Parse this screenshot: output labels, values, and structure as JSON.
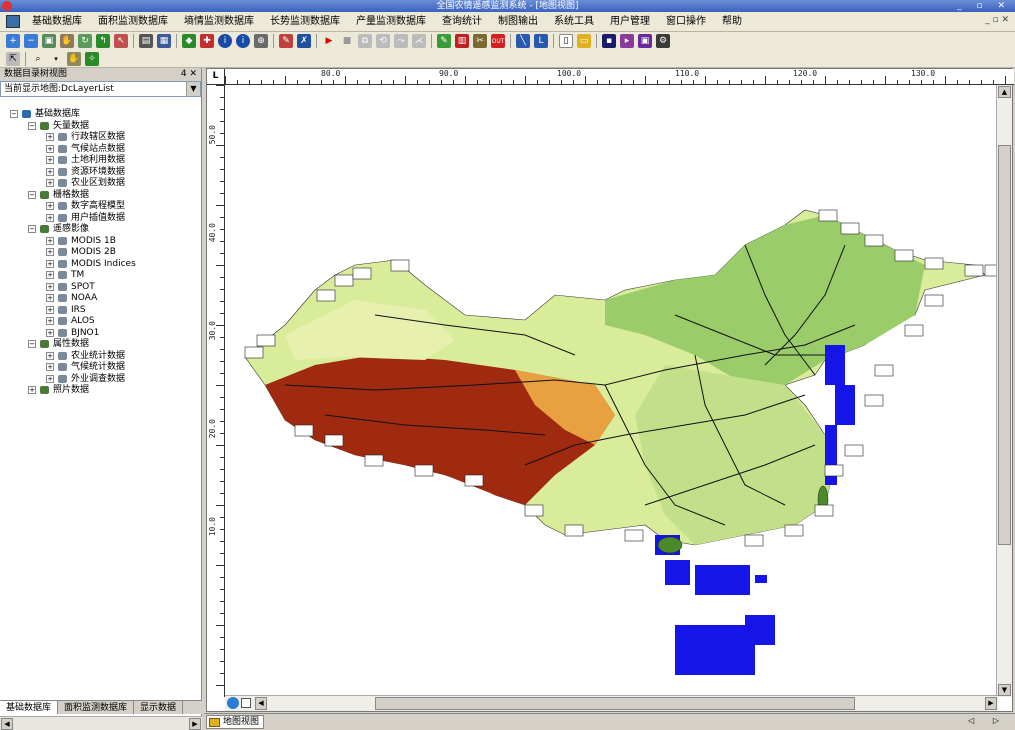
{
  "window": {
    "title": "全国农情遥感监测系统 - [地图视图]",
    "controls": "_ ▫ ✕"
  },
  "menu": {
    "items": [
      "基础数据库",
      "面积监测数据库",
      "墒情监测数据库",
      "长势监测数据库",
      "产量监测数据库",
      "查询统计",
      "制图输出",
      "系统工具",
      "用户管理",
      "窗口操作",
      "帮助"
    ],
    "mdi_controls": "_ ▫ ✕"
  },
  "left_panel": {
    "title": "数据目录树视图",
    "title_controls": "4 ✕",
    "current_map_label": "当前显示地图:DcLayerList",
    "tree": [
      {
        "label": "基础数据库",
        "level": 0,
        "icon": "database-icon",
        "expander": "−"
      },
      {
        "label": "矢量数据",
        "level": 1,
        "icon": "folder-icon",
        "expander": "−"
      },
      {
        "label": "行政辖区数据",
        "level": 2,
        "icon": "layer-icon",
        "expander": "+"
      },
      {
        "label": "气候站点数据",
        "level": 2,
        "icon": "layer-icon",
        "expander": "+"
      },
      {
        "label": "土地利用数据",
        "level": 2,
        "icon": "layer-icon",
        "expander": "+"
      },
      {
        "label": "资源环境数据",
        "level": 2,
        "icon": "layer-icon",
        "expander": "+"
      },
      {
        "label": "农业区划数据",
        "level": 2,
        "icon": "layer-icon",
        "expander": "+"
      },
      {
        "label": "栅格数据",
        "level": 1,
        "icon": "folder-icon",
        "expander": "−"
      },
      {
        "label": "数字高程模型",
        "level": 2,
        "icon": "layer-icon",
        "expander": "+"
      },
      {
        "label": "用户插值数据",
        "level": 2,
        "icon": "layer-icon",
        "expander": "+"
      },
      {
        "label": "遥感影像",
        "level": 1,
        "icon": "folder-icon",
        "expander": "−"
      },
      {
        "label": "MODIS 1B",
        "level": 2,
        "icon": "layer-icon",
        "expander": "+"
      },
      {
        "label": "MODIS 2B",
        "level": 2,
        "icon": "layer-icon",
        "expander": "+"
      },
      {
        "label": "MODIS Indices",
        "level": 2,
        "icon": "layer-icon",
        "expander": "+"
      },
      {
        "label": "TM",
        "level": 2,
        "icon": "layer-icon",
        "expander": "+"
      },
      {
        "label": "SPOT",
        "level": 2,
        "icon": "layer-icon",
        "expander": "+"
      },
      {
        "label": "NOAA",
        "level": 2,
        "icon": "layer-icon",
        "expander": "+"
      },
      {
        "label": "IRS",
        "level": 2,
        "icon": "layer-icon",
        "expander": "+"
      },
      {
        "label": "ALOS",
        "level": 2,
        "icon": "layer-icon",
        "expander": "+"
      },
      {
        "label": "BJNO1",
        "level": 2,
        "icon": "layer-icon",
        "expander": "+"
      },
      {
        "label": "属性数据",
        "level": 1,
        "icon": "folder-icon",
        "expander": "−"
      },
      {
        "label": "农业统计数据",
        "level": 2,
        "icon": "layer-icon",
        "expander": "+"
      },
      {
        "label": "气候统计数据",
        "level": 2,
        "icon": "layer-icon",
        "expander": "+"
      },
      {
        "label": "外业调查数据",
        "level": 2,
        "icon": "layer-icon",
        "expander": "+"
      },
      {
        "label": "照片数据",
        "level": 1,
        "icon": "folder-icon",
        "expander": "+"
      }
    ],
    "tabs": [
      "基础数据库",
      "面积监测数据库",
      "显示数据"
    ]
  },
  "map": {
    "ruler_corner": "L",
    "top_ticks": [
      "80.0",
      "90.0",
      "100.0",
      "110.0",
      "120.0",
      "130.0"
    ],
    "left_ticks": [
      "50.0",
      "40.0",
      "30.0",
      "20.0",
      "10.0"
    ],
    "colors": {
      "water": "#1515e8",
      "high": "#a02a10",
      "mid": "#e8a040",
      "low": "#9acd6a",
      "plain": "#d8ec9a",
      "road": "#111111"
    }
  },
  "bottom_tab": {
    "label": "地图视图",
    "nav": "◁ ▷"
  }
}
